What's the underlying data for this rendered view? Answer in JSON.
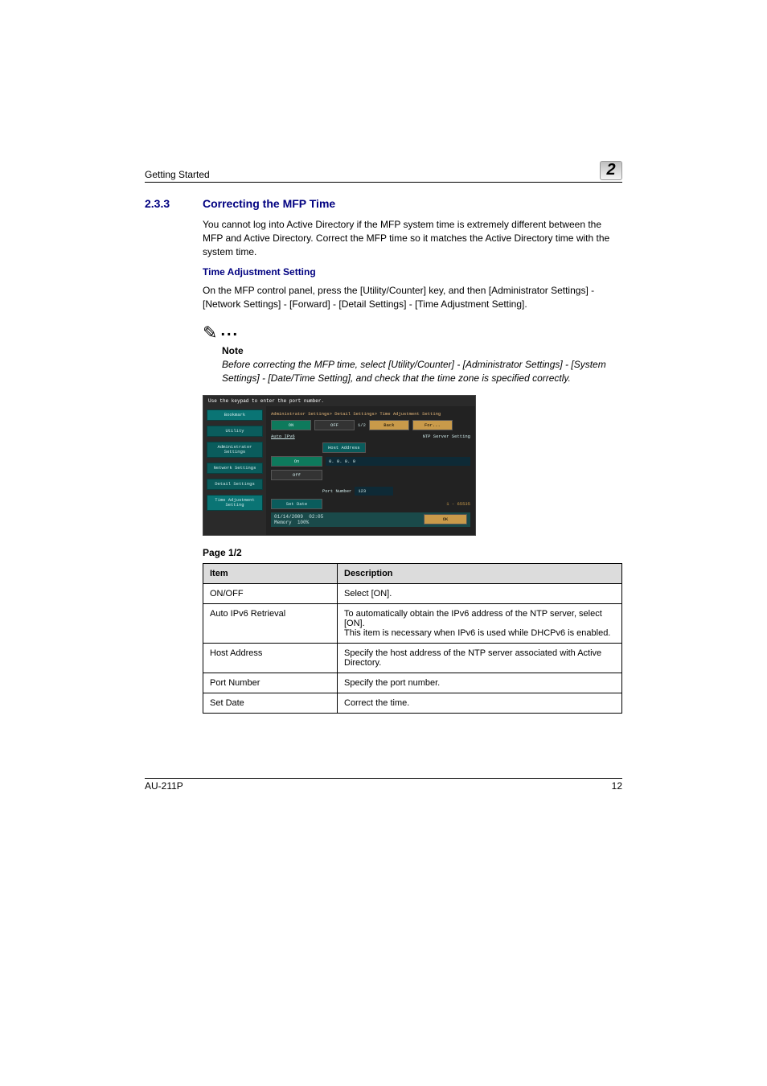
{
  "header": {
    "running_head": "Getting Started",
    "chapter_number": "2"
  },
  "section": {
    "number": "2.3.3",
    "title": "Correcting the MFP Time",
    "intro": "You cannot log into Active Directory if the MFP system time is extremely different between the MFP and Active Directory. Correct the MFP time so it matches the Active Directory time with the system time."
  },
  "subheading": "Time Adjustment Setting",
  "instruction": "On the MFP control panel, press the [Utility/Counter] key, and then [Administrator Settings] - [Network Settings] - [Forward] - [Detail Settings] - [Time Adjustment Setting].",
  "note": {
    "label": "Note",
    "text": "Before correcting the MFP time, select [Utility/Counter] - [Administrator Settings] - [System Settings] - [Date/Time Setting], and check that the time zone is specified correctly."
  },
  "screenshot": {
    "top_hint": "Use the keypad to enter the port number.",
    "side": {
      "bookmark": "Bookmark",
      "utility": "Utility",
      "admin": "Administrator Settings",
      "network": "Network Settings",
      "detail": "Detail Settings",
      "time": "Time Adjustment Setting"
    },
    "breadcrumb": "Administrator Settings> Detail Settings> Time Adjustment Setting",
    "on": "ON",
    "off": "OFF",
    "page_ind": "1/2",
    "back": "Back",
    "fwd": "For...",
    "auto_ipv6": "Auto IPv6",
    "ntp_label": "NTP Server Setting",
    "host_label": "Host Address",
    "host_value": "0. 0. 0. 0",
    "on_small": "On",
    "off_small": "Off",
    "port_label": "Port Number",
    "port_value": "123",
    "port_range": "1 - 65535",
    "set_date": "Set Date",
    "date": "01/14/2009",
    "time": "02:05",
    "memory": "Memory",
    "mem_pct": "100%",
    "ok": "OK"
  },
  "table_caption": "Page 1/2",
  "table": {
    "headers": {
      "item": "Item",
      "desc": "Description"
    },
    "rows": [
      {
        "item": "ON/OFF",
        "desc": "Select [ON]."
      },
      {
        "item": "Auto IPv6 Retrieval",
        "desc": "To automatically obtain the IPv6 address of the NTP server, select [ON].\nThis item is necessary when IPv6 is used while DHCPv6 is enabled."
      },
      {
        "item": "Host Address",
        "desc": "Specify the host address of the NTP server associated with Active Directory."
      },
      {
        "item": "Port Number",
        "desc": "Specify the port number."
      },
      {
        "item": "Set Date",
        "desc": "Correct the time."
      }
    ]
  },
  "footer": {
    "model": "AU-211P",
    "page": "12"
  }
}
